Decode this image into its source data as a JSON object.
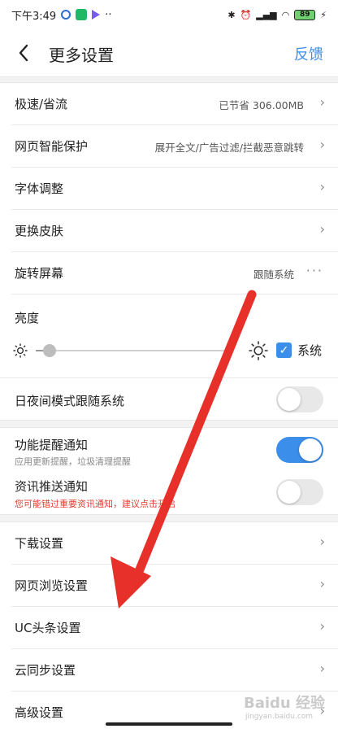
{
  "status_bar": {
    "time": "下午3:49",
    "dots": "··",
    "battery": "89",
    "icons": [
      "bluetooth-icon",
      "alarm-icon",
      "signal-icon",
      "wifi-icon",
      "battery-icon",
      "charging-icon"
    ]
  },
  "header": {
    "title": "更多设置",
    "feedback": "反馈",
    "back_icon": "chevron-left-icon"
  },
  "settings": {
    "speed_saving": {
      "label": "极速/省流",
      "value": "已节省 306.00MB"
    },
    "smart_protect": {
      "label": "网页智能保护",
      "value": "展开全文/广告过滤/拦截恶意跳转"
    },
    "font": {
      "label": "字体调整"
    },
    "skin": {
      "label": "更换皮肤"
    },
    "rotate": {
      "label": "旋转屏幕",
      "value": "跟随系统",
      "more": "···"
    },
    "brightness": {
      "label": "亮度",
      "level": 0.07,
      "system_label": "系统",
      "system_checked": true
    },
    "day_night": {
      "label": "日夜间模式跟随系统",
      "enabled": false
    },
    "feature_notify": {
      "label": "功能提醒通知",
      "note": "应用更新提醒，垃圾清理提醒",
      "enabled": true
    },
    "news_notify": {
      "label": "资讯推送通知",
      "warning": "您可能错过重要资讯通知，建议点击开启",
      "enabled": false
    },
    "download": {
      "label": "下载设置"
    },
    "browse": {
      "label": "网页浏览设置"
    },
    "uc_headlines": {
      "label": "UC头条设置"
    },
    "cloud_sync": {
      "label": "云同步设置"
    },
    "advanced": {
      "label": "高级设置"
    }
  },
  "chevron": "›",
  "watermark": {
    "text": "Baidu 经验",
    "sub": "jingyan.baidu.com"
  },
  "colors": {
    "accent": "#3b8eea",
    "warning": "#e33d33",
    "annotation_arrow": "#e8302a"
  }
}
